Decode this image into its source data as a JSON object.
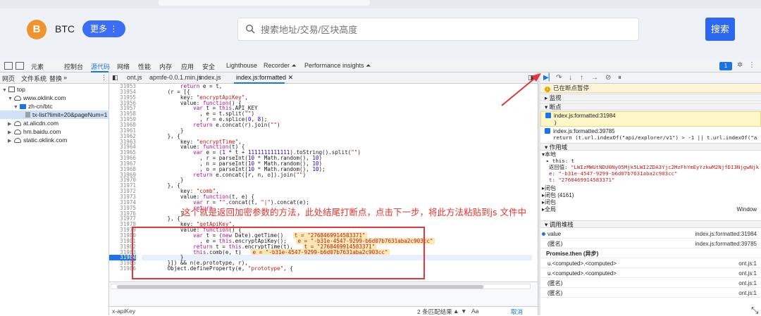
{
  "site": {
    "coin_logo": "B",
    "coin_label": "BTC",
    "more_label": "更多",
    "search_placeholder": "搜索地址/交易/区块高度",
    "search_button": "搜索"
  },
  "devtools": {
    "tabs": [
      "元素",
      "控制台",
      "源代码",
      "网络",
      "性能",
      "内存",
      "应用",
      "安全",
      "Lighthouse",
      "Recorder ⏶",
      "Performance insights ⏶"
    ],
    "active_tab": "源代码",
    "issues_badge": "1",
    "nav_tabs": [
      "网页",
      "文件系统",
      "替换",
      "»"
    ],
    "tree": [
      {
        "indent": 0,
        "tri": "▼",
        "icon": "frame",
        "label": "top"
      },
      {
        "indent": 1,
        "tri": "▼",
        "icon": "cloud",
        "label": "www.oklink.com"
      },
      {
        "indent": 2,
        "tri": "▼",
        "icon": "folder",
        "label": "zh-cn/btc"
      },
      {
        "indent": 3,
        "tri": "",
        "icon": "file",
        "label": "tx-list?limit=20&pageNum=1",
        "selected": true
      },
      {
        "indent": 1,
        "tri": "▶",
        "icon": "cloud",
        "label": "at.alicdn.com"
      },
      {
        "indent": 1,
        "tri": "▶",
        "icon": "cloud",
        "label": "hm.baidu.com"
      },
      {
        "indent": 1,
        "tri": "▶",
        "icon": "cloud",
        "label": "static.oklink.com"
      }
    ],
    "file_tabs": [
      "ont.js",
      "apmfe-0.0.1.min.js",
      "index.js",
      "index.js:formatted"
    ],
    "active_file": "index.js:formatted"
  },
  "code_lines": [
    {
      "n": "31953",
      "t": "            return e = t,"
    },
    {
      "n": "31954",
      "t": "        (r = [{"
    },
    {
      "n": "31955",
      "t": "            key: \"encryptApiKey\","
    },
    {
      "n": "31956",
      "t": "            value: function() {"
    },
    {
      "n": "31957",
      "t": "                var t = this.API_KEY"
    },
    {
      "n": "31958",
      "t": "                  , e = t.split(\"\")"
    },
    {
      "n": "31959",
      "t": "                  , r = e.splice(0, 8);"
    },
    {
      "n": "31960",
      "t": "                return e.concat(r).join(\"\")"
    },
    {
      "n": "31961",
      "t": "            }"
    },
    {
      "n": "31962",
      "t": "        }, {"
    },
    {
      "n": "31963",
      "t": "            key: \"encryptTime\","
    },
    {
      "n": "31964",
      "t": "            value: function(t) {"
    },
    {
      "n": "31965",
      "t": "                var e = (1 * t + 1111111111111).toString().split(\"\")"
    },
    {
      "n": "31966",
      "t": "                  , r = parseInt(10 * Math.random(), 10)"
    },
    {
      "n": "31967",
      "t": "                  , n = parseInt(10 * Math.random(), 10)"
    },
    {
      "n": "31968",
      "t": "                  , o = parseInt(10 * Math.random(), 10);"
    },
    {
      "n": "31969",
      "t": "                return e.concat([r, n, o]).join(\"\")"
    },
    {
      "n": "31970",
      "t": "            }"
    },
    {
      "n": "31971",
      "t": "        }, {"
    },
    {
      "n": "31972",
      "t": "            key: \"comb\","
    },
    {
      "n": "31973",
      "t": "            value: function(t, e) {"
    },
    {
      "n": "31974",
      "t": "                var r = \"\".concat(t, \"|\").concat(e);"
    },
    {
      "n": "31975",
      "t": "                return"
    },
    {
      "n": "31976",
      "t": "            }"
    },
    {
      "n": "31977",
      "t": "        }, {"
    },
    {
      "n": "31978",
      "t": "            key: \"getApiKey\","
    },
    {
      "n": "31979",
      "t": "            value: function() {"
    },
    {
      "n": "31980",
      "t": "                var t = (new Date).getTime()",
      "v": "t = \"2768469914583371\""
    },
    {
      "n": "31981",
      "t": "                  , e = this.encryptApiKey();",
      "v": "e = \"-b31e-4547-9299-b6d07b7631aba2c903cc\""
    },
    {
      "n": "31982",
      "t": "                return t = this.encryptTime(t),",
      "v": "t = \"2768469914583371\""
    },
    {
      "n": "31983",
      "t": "                this.comb(e, t)",
      "v": "e = \"-b31e-4547-9299-b6d07b7631aba2c903cc\""
    },
    {
      "n": "31984",
      "t": "            }",
      "current": true
    },
    {
      "n": "31985",
      "t": "        }]) && n(e.prototype, r),"
    },
    {
      "n": "31986",
      "t": "        Object.defineProperty(e, \"prototype\", {"
    }
  ],
  "annotation": "这个就是返回加密参数的方法，此处结尾打断点，点击下一步，将此方法粘贴到js 文件中",
  "editor_footer": {
    "search_value": "x-apiKey",
    "match_info": "2 条匹配结果",
    "aa": "Aa",
    "cancel": "取消"
  },
  "debugger": {
    "paused": "已在断点暂停",
    "watch": "监视",
    "breakpoints_title": "断点",
    "bp1_loc": "index.js:formatted:31984",
    "bp1_code": "}",
    "bp2_loc": "index.js:formatted:39785",
    "bp2_code": "return (t.url.indexOf(\"api/explorer/v1\") > -1 || t.url.indexOf(\"a…",
    "scope_title": "作用域",
    "local": "本地",
    "this_row": "▸ this: t",
    "return_label": "返回值:",
    "return_value": "\"LWIzMWUtNDU0Ny05Mjk5LWI2ZDA3Yjc2MzFhYmEyYzkwM2NjfDI3NjgwNjkSM\"",
    "e_label": "e:",
    "e_value": "\"-b31e-4547-9299-b6d07b7631aba2c903cc\"",
    "t_label": "t:",
    "t_value": "\"2768469914583371\"",
    "closure1": "闭包",
    "closure2": "闭包 (4161)",
    "closure3": "闭包",
    "global": "全局",
    "global_value": "Window",
    "callstack_title": "调用堆栈",
    "callstack": [
      {
        "fn": "value",
        "loc": "index.js:formatted:31984",
        "active": true
      },
      {
        "fn": "(匿名)",
        "loc": "index.js:formatted:39785"
      },
      {
        "fn": "Promise.then (异步)",
        "loc": "",
        "bold": true
      },
      {
        "fn": "u.<computed>.<computed>",
        "loc": "ont.js:1"
      },
      {
        "fn": "u.<computed>.<computed>",
        "loc": "ont.js:1"
      },
      {
        "fn": "(匿名)",
        "loc": "ont.js:1"
      },
      {
        "fn": "(匿名)",
        "loc": "ont.js:1"
      }
    ]
  }
}
